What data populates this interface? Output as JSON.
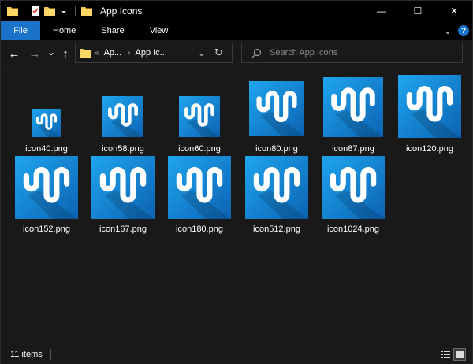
{
  "window": {
    "title": "App Icons"
  },
  "title_bar": {
    "minimize_symbol": "—",
    "maximize_symbol": "☐",
    "close_symbol": "✕"
  },
  "ribbon": {
    "tabs": [
      {
        "label": "File"
      },
      {
        "label": "Home"
      },
      {
        "label": "Share"
      },
      {
        "label": "View"
      }
    ],
    "expand_symbol": "⌄",
    "help_symbol": "?"
  },
  "nav": {
    "back_symbol": "←",
    "forward_symbol": "→",
    "recent_symbol": "⌄",
    "up_symbol": "↑",
    "address": {
      "prefix": "«",
      "segments": [
        "Ap...",
        "App Ic..."
      ],
      "separator": "›"
    },
    "search": {
      "placeholder": "Search App Icons"
    }
  },
  "files": [
    {
      "name": "icon40.png"
    },
    {
      "name": "icon58.png"
    },
    {
      "name": "icon60.png"
    },
    {
      "name": "icon80.png"
    },
    {
      "name": "icon87.png"
    },
    {
      "name": "icon120.png"
    },
    {
      "name": "icon152.png"
    },
    {
      "name": "icon167.png"
    },
    {
      "name": "icon180.png"
    },
    {
      "name": "icon512.png"
    },
    {
      "name": "icon1024.png"
    }
  ],
  "status_bar": {
    "item_count": "11 items"
  },
  "colors": {
    "accent": "#1a73c8",
    "icon_gradient_top": "#1fa5ee",
    "icon_gradient_bottom": "#0c63b3",
    "background": "#191919"
  }
}
